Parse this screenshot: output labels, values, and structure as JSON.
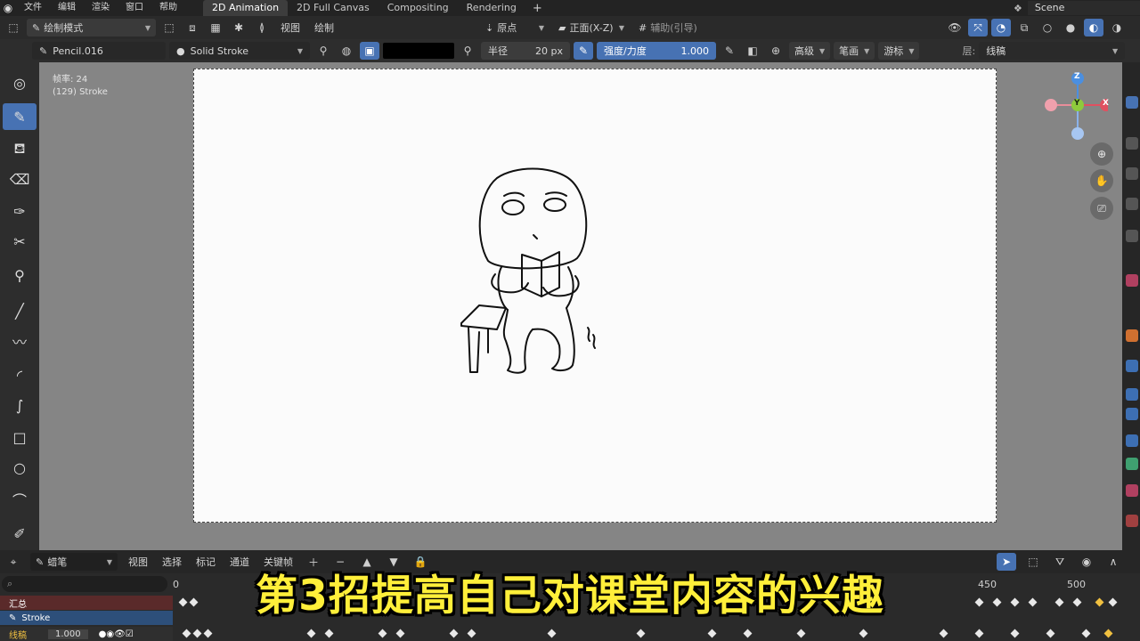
{
  "menubar": {
    "items": [
      "文件",
      "编辑",
      "渲染",
      "窗口",
      "帮助"
    ],
    "workspace_tabs": [
      "2D Animation",
      "2D Full Canvas",
      "Compositing",
      "Rendering"
    ],
    "add_tab": "+",
    "scene": "Scene"
  },
  "header": {
    "mode": "绘制模式",
    "view_menu": "视图",
    "draw_menu": "绘制",
    "origin": "原点",
    "orientation": "正面(X-Z)",
    "guides": "辅助(引导)"
  },
  "tool_settings": {
    "object_name": "Pencil.016",
    "material": "Solid Stroke",
    "radius_label": "半径",
    "radius_value": "20 px",
    "strength_label": "强度/力度",
    "strength_value": "1.000",
    "advanced": "高级",
    "stroke": "笔画",
    "cursor": "游标",
    "layer_label": "层:",
    "layer_value": "线稿"
  },
  "viewport": {
    "fps_info": "帧率: 24",
    "object_info": "(129) Stroke"
  },
  "gizmo": {
    "z": "Z",
    "y": "Y",
    "x": "X"
  },
  "timeline": {
    "mode": "蜡笔",
    "menus": [
      "视图",
      "选择",
      "标记",
      "通道",
      "关键帧"
    ],
    "search_placeholder": "",
    "frame_0": "0",
    "frame_450": "450",
    "frame_500": "500",
    "row_summary": "汇总",
    "row_stroke": "Stroke",
    "row_layer": "线稿",
    "layer_opacity": "1.000"
  },
  "subtitle": "第3招提高自己对课堂内容的兴趣",
  "colors": {
    "accent": "#4772b3",
    "subtitle_fill": "#ffef3a",
    "canvas": "#fbfbfb",
    "axis_x": "#e05060",
    "axis_y": "#8ecb3c",
    "axis_z": "#4b8fe0"
  }
}
